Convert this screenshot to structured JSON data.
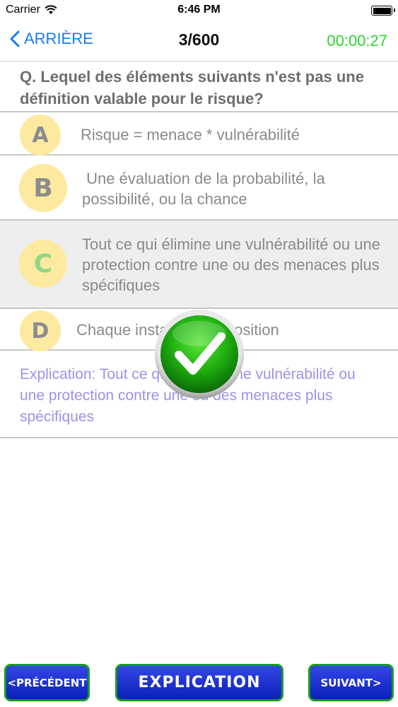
{
  "status_bar": {
    "carrier": "Carrier",
    "time": "6:46 PM",
    "wifi_icon": "wifi-icon",
    "battery_icon": "battery-icon"
  },
  "nav": {
    "back_label": "ARRIÈRE",
    "back_icon": "chevron-left-icon",
    "progress": "3/600",
    "timer": "00:00:27",
    "accent_color": "#1a7bf0",
    "timer_color": "#2bd62b"
  },
  "question": {
    "text": "Q.  Lequel des éléments suivants n'est pas une définition valable pour le risque?"
  },
  "options": [
    {
      "letter": "A",
      "text": "Risque = menace * vulnérabilité",
      "selected": false,
      "correct": false
    },
    {
      "letter": "B",
      "text": " Une évaluation de la probabilité, la possibilité, ou la chance",
      "selected": false,
      "correct": false
    },
    {
      "letter": "C",
      "text": "Tout ce qui élimine une vulnérabilité ou une protection contre une ou des menaces plus spécifiques",
      "selected": true,
      "correct": true
    },
    {
      "letter": "D",
      "text": "Chaque instance d'exposition",
      "selected": false,
      "correct": false
    }
  ],
  "explanation": {
    "text": "Explication: Tout ce qui élimine une vulnérabilité ou une protection contre une ou des menaces plus spécifiques",
    "color": "#9c92e6"
  },
  "result_icon": "check-circle-icon",
  "buttons": {
    "previous": "<PRÉCÉDENT",
    "explanation": "EXPLICATION",
    "next": "SUIVANT>",
    "color": "#1f33d6",
    "border_color": "#1a9a2a"
  }
}
